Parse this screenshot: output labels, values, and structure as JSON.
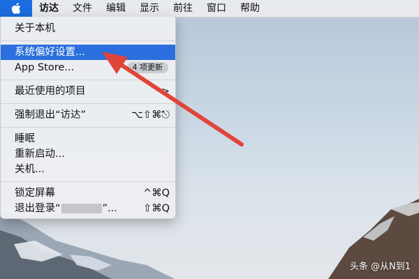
{
  "menubar": {
    "items": [
      {
        "label": "访达"
      },
      {
        "label": "文件"
      },
      {
        "label": "编辑"
      },
      {
        "label": "显示"
      },
      {
        "label": "前往"
      },
      {
        "label": "窗口"
      },
      {
        "label": "帮助"
      }
    ]
  },
  "apple_menu": {
    "about": "关于本机",
    "system_prefs": "系统偏好设置...",
    "app_store": "App Store...",
    "app_store_badge": "4 项更新",
    "recent_items": "最近使用的项目",
    "recent_items_arrow": ">",
    "force_quit": "强制退出“访达”",
    "force_quit_shortcut": "⌥⇧⌘⎋",
    "sleep": "睡眠",
    "restart": "重新启动...",
    "shutdown": "关机...",
    "lock_screen": "锁定屏幕",
    "lock_screen_shortcut": "^⌘Q",
    "logout_prefix": "退出登录“",
    "logout_suffix": "”...",
    "logout_shortcut": "⇧⌘Q"
  },
  "watermark": "头条 @从N到1",
  "colors": {
    "highlight": "#2a6fdd",
    "arrow": "#e0453a",
    "apple_active": "#1b6de0"
  }
}
